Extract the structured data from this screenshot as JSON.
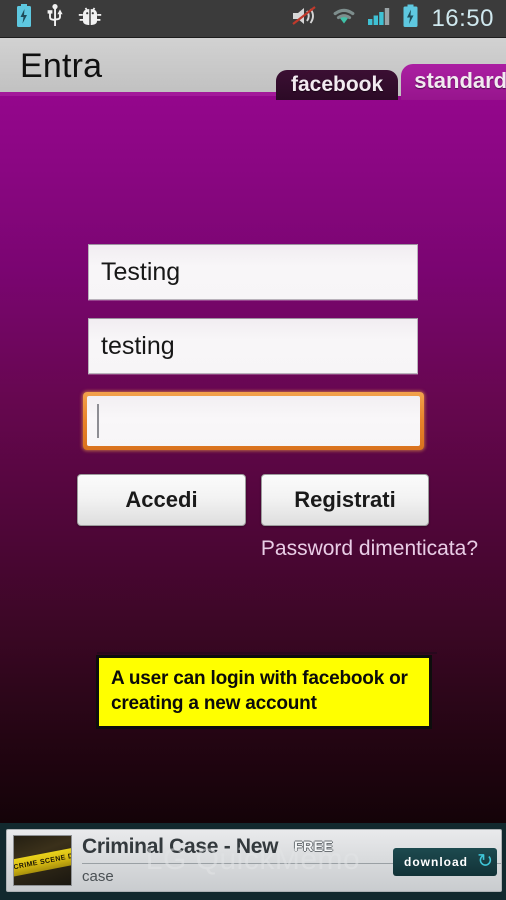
{
  "statusbar": {
    "clock": "16:50",
    "icons_left": [
      "battery-charging-icon",
      "usb-icon",
      "android-debug-bug-icon"
    ],
    "icons_right": [
      "volume-muted-icon",
      "wifi-icon",
      "cellular-signal-icon",
      "battery-charging-icon"
    ]
  },
  "titlebar": {
    "title": "Entra",
    "accent_color": "#a3199a"
  },
  "tabs": [
    {
      "label": "facebook",
      "active": false
    },
    {
      "label": "standard",
      "active": true
    }
  ],
  "form": {
    "username": {
      "value": "Testing",
      "placeholder": ""
    },
    "email": {
      "value": "testing",
      "placeholder": ""
    },
    "password": {
      "value": "",
      "placeholder": "",
      "focused": true
    }
  },
  "buttons": {
    "login": "Accedi",
    "register": "Registrati"
  },
  "links": {
    "forgot_password": "Password dimenticata?"
  },
  "annotation": {
    "text": "A user can login with facebook or creating a new account",
    "background_color": "#ffff00",
    "border_color": "#0d0d0d"
  },
  "ad": {
    "title": "Criminal Case - New",
    "badge": "FREE",
    "subtitle": "case",
    "download_label": "download",
    "refresh_icon": "refresh-icon",
    "thumbnail_text": "CRIME SCENE DO"
  },
  "watermark": {
    "text": "LG QuickMemo"
  }
}
